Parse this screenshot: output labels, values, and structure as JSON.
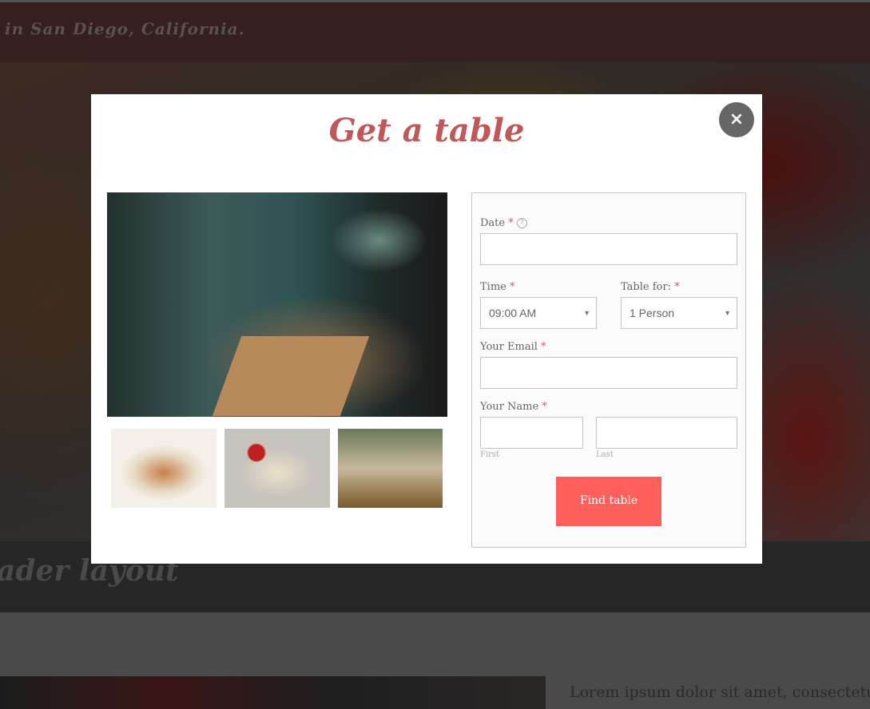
{
  "background": {
    "tagline": "in San Diego, California.",
    "band_title": "ader layout",
    "lorem": "Lorem ipsum dolor sit amet, consectetuer"
  },
  "modal": {
    "title": "Get a table",
    "close_icon": "×",
    "form": {
      "date_label": "Date",
      "date_help": "?",
      "date_value": "",
      "time_label": "Time",
      "time_value": "09:00 AM",
      "table_for_label": "Table for:",
      "table_for_value": "1 Person",
      "email_label": "Your Email",
      "email_value": "",
      "name_label": "Your Name",
      "first_sublabel": "First",
      "last_sublabel": "Last",
      "required_mark": "*",
      "submit_label": "Find table"
    }
  },
  "colors": {
    "accent": "#fe5f5a",
    "title": "#c0585a"
  }
}
